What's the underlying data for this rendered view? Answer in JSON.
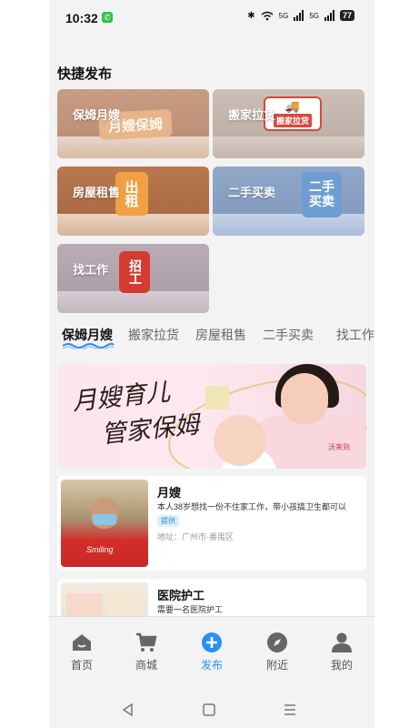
{
  "status": {
    "time": "10:32",
    "network": "5G",
    "network2": "5G",
    "battery": "77"
  },
  "quick_publish": {
    "title": "快捷发布",
    "cards": [
      {
        "label": "保姆月嫂",
        "sign": "月嫂保姆"
      },
      {
        "label": "搬家拉货",
        "sign": "搬家拉货"
      },
      {
        "label": "房屋租售",
        "sign": "出租"
      },
      {
        "label": "二手买卖",
        "sign": "二手买卖"
      },
      {
        "label": "找工作",
        "sign": "招工"
      }
    ]
  },
  "category_tabs": [
    "保姆月嫂",
    "搬家拉货",
    "房屋租售",
    "二手买卖",
    "找工作"
  ],
  "banner": {
    "line1": "月嫂育儿",
    "line2": "管家保姆",
    "badge": "沃来到"
  },
  "listings": [
    {
      "title": "月嫂",
      "desc": "本人38岁想找一份不住家工作，带小孩搞卫生都可以",
      "tag": "提供",
      "address": "地址：广州市-番禺区",
      "shirt_text": "Smiling"
    },
    {
      "title": "医院护工",
      "desc": "需要一名医院护工"
    }
  ],
  "tabbar": [
    {
      "label": "首页",
      "icon": "home-icon"
    },
    {
      "label": "商城",
      "icon": "cart-icon"
    },
    {
      "label": "发布",
      "icon": "plus-circle-icon"
    },
    {
      "label": "附近",
      "icon": "compass-icon"
    },
    {
      "label": "我的",
      "icon": "user-icon"
    }
  ],
  "colors": {
    "accent": "#2b8ff3",
    "tag_bg": "#dcefff",
    "page_bg": "#f3f3f3"
  }
}
